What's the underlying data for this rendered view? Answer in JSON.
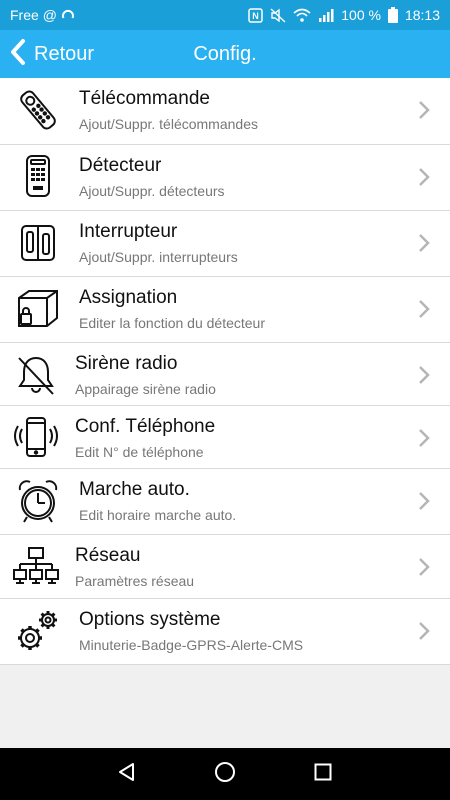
{
  "status_bar": {
    "carrier": "Free",
    "carrier_suffix": "@",
    "battery": "100 %",
    "time": "18:13"
  },
  "header": {
    "back_label": "Retour",
    "title": "Config."
  },
  "menu": [
    {
      "title": "Télécommande",
      "subtitle": "Ajout/Suppr. télécommandes",
      "icon": "remote-control-icon"
    },
    {
      "title": "Détecteur",
      "subtitle": "Ajout/Suppr. détecteurs",
      "icon": "detector-keypad-icon"
    },
    {
      "title": "Interrupteur",
      "subtitle": "Ajout/Suppr. interrupteurs",
      "icon": "switch-icon"
    },
    {
      "title": "Assignation",
      "subtitle": "Editer la fonction du détecteur",
      "icon": "assignment-box-lock-icon"
    },
    {
      "title": "Sirène radio",
      "subtitle": "Appairage sirène radio",
      "icon": "bell-off-icon"
    },
    {
      "title": "Conf. Téléphone",
      "subtitle": "Edit N° de téléphone",
      "icon": "phone-icon"
    },
    {
      "title": "Marche auto.",
      "subtitle": "Edit horaire marche auto.",
      "icon": "alarm-clock-icon"
    },
    {
      "title": "Réseau",
      "subtitle": "Paramètres réseau",
      "icon": "network-icon"
    },
    {
      "title": "Options système",
      "subtitle": "Minuterie-Badge-GPRS-Alerte-CMS",
      "icon": "gears-icon"
    }
  ],
  "colors": {
    "status_bar": "#1a9fd9",
    "header": "#29b1f2",
    "nav_bar": "#000000",
    "background": "#f0f0f0"
  }
}
